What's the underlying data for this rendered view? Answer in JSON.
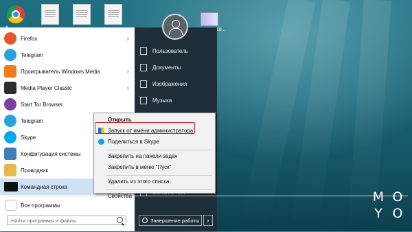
{
  "desktop": {
    "thumb_label": "18...",
    "brand": [
      "M",
      "O",
      "Y",
      "O"
    ]
  },
  "start_menu": {
    "apps": [
      {
        "label": "Firefox",
        "icon": "firefox-icon",
        "arrow": true,
        "color": "#e5562d"
      },
      {
        "label": "Telegram",
        "icon": "telegram-icon",
        "arrow": false,
        "color": "#2aa3dd"
      },
      {
        "label": "Проигрыватель Windows Media",
        "icon": "media-player-icon",
        "arrow": true,
        "color": "#f07c1d"
      },
      {
        "label": "Media Player Classic",
        "icon": "mpc-icon",
        "arrow": true,
        "color": "#2e2e2e"
      },
      {
        "label": "Start Tor Browser",
        "icon": "tor-icon",
        "arrow": false,
        "color": "#7c3f9c"
      },
      {
        "label": "Telegram",
        "icon": "telegram-icon",
        "arrow": false,
        "color": "#2aa3dd"
      },
      {
        "label": "Skype",
        "icon": "skype-icon",
        "arrow": false,
        "color": "#00a9f0"
      },
      {
        "label": "Конфигурация системы",
        "icon": "msconfig-icon",
        "arrow": false,
        "color": "#3f7fb5"
      },
      {
        "label": "Проводник",
        "icon": "explorer-icon",
        "arrow": false,
        "color": "#e8b94a"
      },
      {
        "label": "Командная строка",
        "icon": "cmd-icon",
        "arrow": false,
        "color": "#111111"
      }
    ],
    "all_programs": "Все программы",
    "search_placeholder": "Найти программы и файлы",
    "right_items": [
      {
        "label": "Пользователь",
        "icon": "user-folder-icon"
      },
      {
        "label": "Документы",
        "icon": "documents-icon"
      },
      {
        "label": "Изображения",
        "icon": "pictures-icon"
      },
      {
        "label": "Музыка",
        "icon": "music-icon"
      }
    ],
    "run_label": "Выполнить...",
    "shutdown": "Завершение работы"
  },
  "context_menu": {
    "items": [
      {
        "label": "Открыть",
        "bold": true,
        "icon": null
      },
      {
        "label": "Запуск от имени администратора",
        "bold": false,
        "icon": "shield-icon"
      },
      {
        "label": "Поделиться в Skype",
        "bold": false,
        "icon": "skype-icon"
      },
      {
        "sep": true
      },
      {
        "label": "Закрепить на панели задач",
        "bold": false,
        "icon": null
      },
      {
        "label": "Закрепить в меню \"Пуск\"",
        "bold": false,
        "icon": null
      },
      {
        "sep": true
      },
      {
        "label": "Удалить из этого списка",
        "bold": false,
        "icon": null
      },
      {
        "sep": true
      },
      {
        "label": "Свойства",
        "bold": false,
        "icon": null
      }
    ],
    "highlight_color": "#d9232d"
  },
  "colors": {
    "start_dark": "#1f2f39",
    "highlight": "#cfe2f3"
  }
}
